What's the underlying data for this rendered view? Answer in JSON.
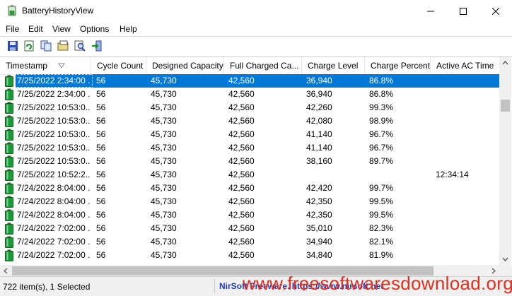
{
  "window": {
    "title": "BatteryHistoryView"
  },
  "menu": [
    "File",
    "Edit",
    "View",
    "Options",
    "Help"
  ],
  "toolbar": [
    {
      "icon": "save-icon"
    },
    {
      "icon": "refresh-icon"
    },
    {
      "icon": "copy-icon"
    },
    {
      "icon": "properties-icon"
    },
    {
      "icon": "find-icon"
    },
    {
      "icon": "exit-icon"
    }
  ],
  "columns": [
    "Timestamp",
    "Cycle Count",
    "Designed Capacity",
    "Full Charged Ca...",
    "Charge Level",
    "Charge Percent",
    "Active AC Time"
  ],
  "rows": [
    {
      "timestamp": "7/25/2022 2:34:00 ...",
      "cycle": "56",
      "designed": "45,730",
      "full": "42,560",
      "level": "36,940",
      "percent": "86.8%",
      "ac": "",
      "selected": true
    },
    {
      "timestamp": "7/25/2022 2:34:00 ...",
      "cycle": "56",
      "designed": "45,730",
      "full": "42,560",
      "level": "36,940",
      "percent": "86.8%",
      "ac": ""
    },
    {
      "timestamp": "7/25/2022 10:53:0...",
      "cycle": "56",
      "designed": "45,730",
      "full": "42,560",
      "level": "42,260",
      "percent": "99.3%",
      "ac": ""
    },
    {
      "timestamp": "7/25/2022 10:53:0...",
      "cycle": "56",
      "designed": "45,730",
      "full": "42,560",
      "level": "42,080",
      "percent": "98.9%",
      "ac": ""
    },
    {
      "timestamp": "7/25/2022 10:53:0...",
      "cycle": "56",
      "designed": "45,730",
      "full": "42,560",
      "level": "41,140",
      "percent": "96.7%",
      "ac": ""
    },
    {
      "timestamp": "7/25/2022 10:53:0...",
      "cycle": "56",
      "designed": "45,730",
      "full": "42,560",
      "level": "41,140",
      "percent": "96.7%",
      "ac": ""
    },
    {
      "timestamp": "7/25/2022 10:53:0...",
      "cycle": "56",
      "designed": "45,730",
      "full": "42,560",
      "level": "38,160",
      "percent": "89.7%",
      "ac": ""
    },
    {
      "timestamp": "7/25/2022 10:52:2...",
      "cycle": "56",
      "designed": "45,730",
      "full": "42,560",
      "level": "",
      "percent": "",
      "ac": "12:34:14"
    },
    {
      "timestamp": "7/24/2022 8:04:00 ...",
      "cycle": "56",
      "designed": "45,730",
      "full": "42,560",
      "level": "42,420",
      "percent": "99.7%",
      "ac": ""
    },
    {
      "timestamp": "7/24/2022 8:04:00 ...",
      "cycle": "56",
      "designed": "45,730",
      "full": "42,560",
      "level": "42,350",
      "percent": "99.5%",
      "ac": ""
    },
    {
      "timestamp": "7/24/2022 8:04:00 ...",
      "cycle": "56",
      "designed": "45,730",
      "full": "42,560",
      "level": "42,350",
      "percent": "99.5%",
      "ac": ""
    },
    {
      "timestamp": "7/24/2022 7:02:00 ...",
      "cycle": "56",
      "designed": "45,730",
      "full": "42,560",
      "level": "35,010",
      "percent": "82.3%",
      "ac": ""
    },
    {
      "timestamp": "7/24/2022 7:02:00 ...",
      "cycle": "56",
      "designed": "45,730",
      "full": "42,560",
      "level": "34,940",
      "percent": "82.1%",
      "ac": ""
    },
    {
      "timestamp": "7/24/2022 7:02:00 ...",
      "cycle": "56",
      "designed": "45,730",
      "full": "42,560",
      "level": "34,840",
      "percent": "81.9%",
      "ac": ""
    }
  ],
  "status": {
    "count": "722 item(s), 1 Selected",
    "nirsoft": "NirSoft Freeware. https://www.nirsoft.net"
  },
  "watermark": "www.freesoftwaresdownload.org",
  "colors": {
    "selection": "#0078d7",
    "battery": "#1a9a3a",
    "link": "#1e3fbf",
    "watermark": "#e0301e"
  }
}
